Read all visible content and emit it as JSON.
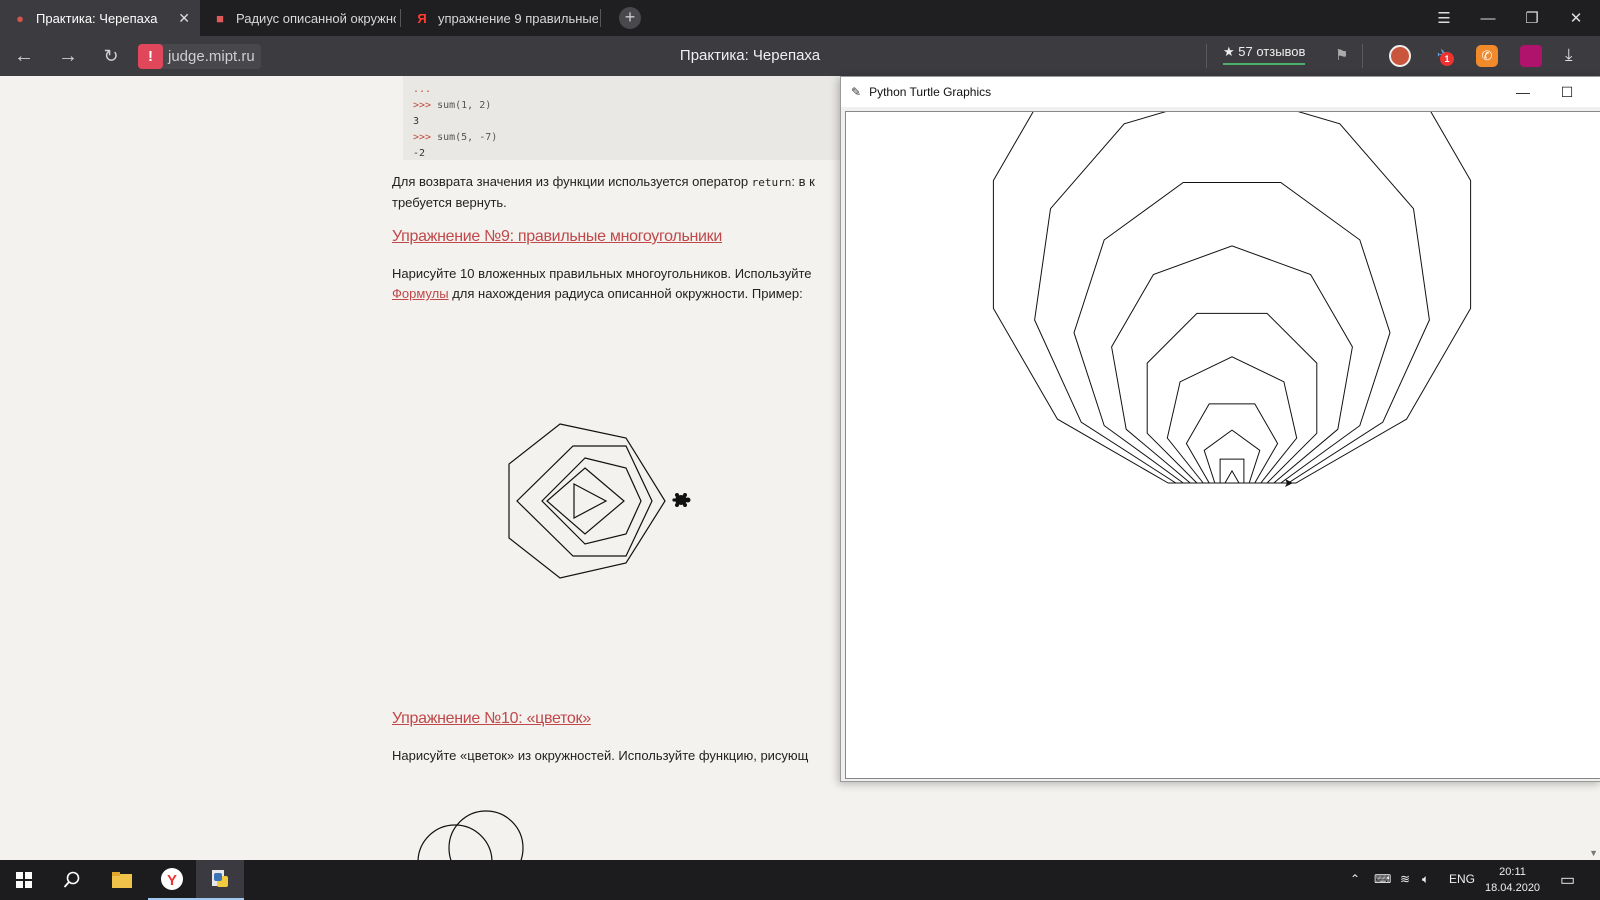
{
  "tabs": [
    {
      "title": "Практика: Черепаха",
      "active": true
    },
    {
      "title": "Радиус описанной окружности"
    },
    {
      "title": "упражнение 9 правильные"
    }
  ],
  "tab_icons": [
    "turtle-icon",
    "wiki-book-icon",
    "yandex-icon"
  ],
  "address": {
    "url": "judge.mipt.ru",
    "page_title": "Практика: Черепаха",
    "reviews": "★ 57 отзывов",
    "notification_count": "1"
  },
  "window_controls": {
    "menu": "☰",
    "minimize": "—",
    "restore": "❐",
    "close": "✕"
  },
  "code": {
    "lines": [
      {
        "prompt": "...",
        "code": ""
      },
      {
        "prompt": ">>>",
        "code": " sum(1, 2)"
      },
      {
        "prompt": "",
        "code": "3"
      },
      {
        "prompt": ">>>",
        "code": " sum(5, -7)"
      },
      {
        "prompt": "",
        "code": "-2"
      }
    ]
  },
  "article": {
    "return_text_before": "Для возврата значения из функции используется оператор ",
    "return_keyword": "return",
    "return_text_after": ": в к",
    "return_line2": "требуется вернуть.",
    "ex9_heading": "Упражнение №9: правильные многоугольники",
    "ex9_line1": "Нарисуйте 10 вложенных правильных многоугольников. Используйте",
    "ex9_link": "Формулы",
    "ex9_line2_rest": " для нахождения радиуса описанной окружности. Пример:",
    "ex10_heading": "Упражнение №10: «цветок»",
    "ex10_line1": "Нарисуйте «цветок» из окружностей. Используйте функцию, рисующ"
  },
  "turtle_window": {
    "title": "Python Turtle Graphics",
    "minimize": "—",
    "maximize": "☐"
  },
  "taskbar": {
    "language": "ENG",
    "time": "20:11",
    "date": "18.04.2020",
    "icons": [
      "windows-start-icon",
      "search-icon",
      "file-explorer-icon",
      "yandex-browser-icon",
      "python-icon"
    ]
  }
}
